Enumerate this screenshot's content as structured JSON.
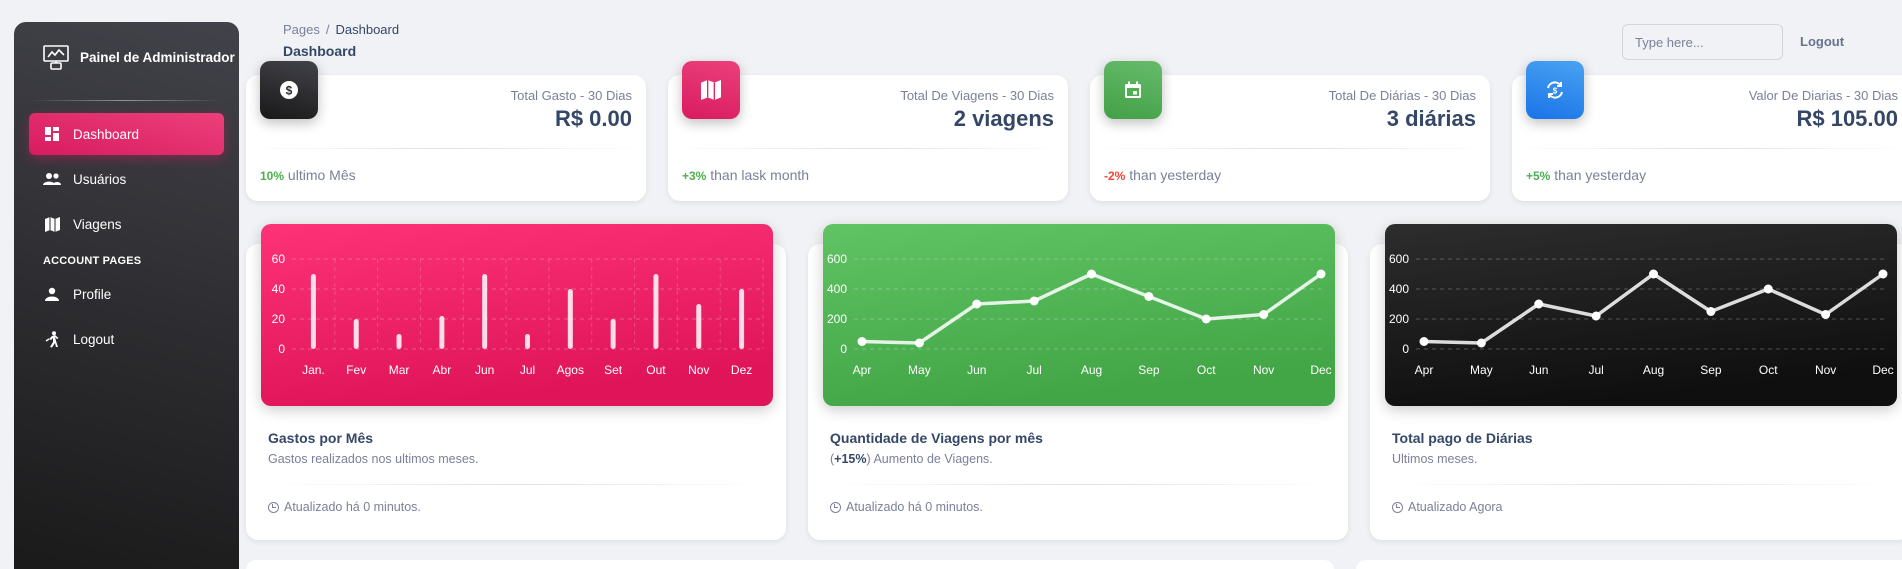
{
  "sidebar": {
    "brand": "Painel de Administrador",
    "items": [
      {
        "label": "Dashboard"
      },
      {
        "label": "Usuários"
      },
      {
        "label": "Viagens"
      }
    ],
    "section_title": "ACCOUNT PAGES",
    "account_items": [
      {
        "label": "Profile"
      },
      {
        "label": "Logout"
      }
    ]
  },
  "header": {
    "breadcrumb_root": "Pages",
    "breadcrumb_sep": "/",
    "breadcrumb_current": "Dashboard",
    "title": "Dashboard",
    "search_placeholder": "Type here...",
    "logout": "Logout"
  },
  "stats": [
    {
      "label": "Total Gasto - 30 Dias",
      "value": "R$ 0.00",
      "change": "10%",
      "change_text": " ultimo Mês",
      "color": "#191919",
      "icon": "dollar-icon"
    },
    {
      "label": "Total De Viagens - 30 Dias",
      "value": "2 viagens",
      "change": "+3%",
      "change_text": " than lask month",
      "color": "#e91e63",
      "icon": "map-icon"
    },
    {
      "label": "Total De Diárias - 30 Dias",
      "value": "3 diárias",
      "change": "-2%",
      "change_text": " than yesterday",
      "color": "#4caf50",
      "icon": "calendar-icon"
    },
    {
      "label": "Valor De Diarias - 30 Dias",
      "value": "R$ 105.00",
      "change": "+5%",
      "change_text": " than yesterday",
      "color": "#1a73e8",
      "icon": "exchange-icon"
    }
  ],
  "charts": [
    {
      "title": "Gastos por Mês",
      "subtitle": "Gastos realizados nos ultimos meses.",
      "footer": "Atualizado há 0 minutos."
    },
    {
      "title": "Quantidade de Viagens por mês",
      "subtitle_bold": "+15%",
      "subtitle": " Aumento de Viagens.",
      "footer": "Atualizado há 0 minutos."
    },
    {
      "title": "Total pago de Diárias",
      "subtitle": "Ultimos meses.",
      "footer": "Atualizado Agora"
    }
  ],
  "chart_data": [
    {
      "type": "bar",
      "categories": [
        "Jan.",
        "Fev",
        "Mar",
        "Abr",
        "Jun",
        "Jul",
        "Agos",
        "Set",
        "Out",
        "Nov",
        "Dez"
      ],
      "values": [
        50,
        20,
        10,
        22,
        50,
        10,
        40,
        20,
        50,
        30,
        40
      ],
      "ylim": [
        0,
        60
      ],
      "yticks": [
        0,
        20,
        40,
        60
      ],
      "grid": true,
      "background": "#e91e63"
    },
    {
      "type": "line",
      "categories": [
        "Apr",
        "May",
        "Jun",
        "Jul",
        "Aug",
        "Sep",
        "Oct",
        "Nov",
        "Dec"
      ],
      "values": [
        50,
        40,
        300,
        320,
        500,
        350,
        200,
        230,
        500
      ],
      "ylim": [
        0,
        600
      ],
      "yticks": [
        0,
        200,
        400,
        600
      ],
      "grid": true,
      "background": "#4caf50"
    },
    {
      "type": "line",
      "categories": [
        "Apr",
        "May",
        "Jun",
        "Jul",
        "Aug",
        "Sep",
        "Oct",
        "Nov",
        "Dec"
      ],
      "values": [
        50,
        40,
        300,
        220,
        500,
        250,
        400,
        230,
        500
      ],
      "ylim": [
        0,
        600
      ],
      "yticks": [
        0,
        200,
        400,
        600
      ],
      "grid": true,
      "background": "#191919"
    }
  ]
}
